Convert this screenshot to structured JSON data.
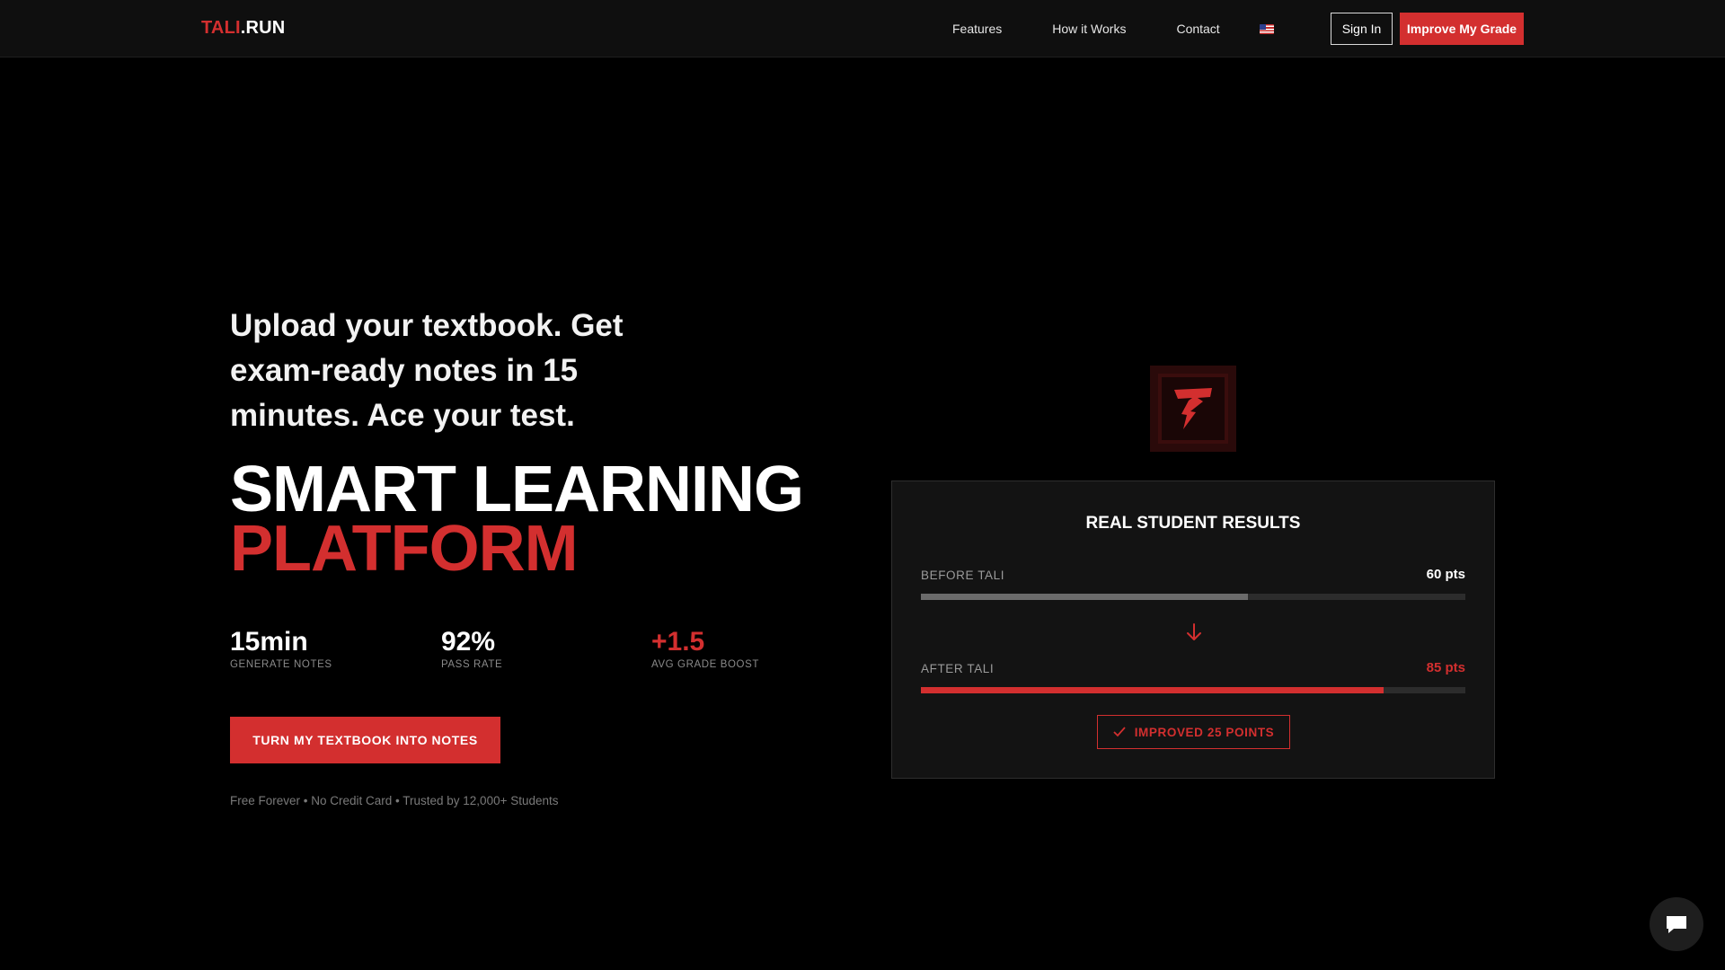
{
  "nav": {
    "logo_part1": "TALI",
    "logo_part2": ".RUN",
    "links": [
      "Features",
      "How it Works",
      "Contact"
    ],
    "language_icon": "us-flag-icon",
    "sign_in": "Sign In",
    "improve": "Improve My Grade"
  },
  "hero": {
    "tagline": "Upload your textbook. Get exam-ready notes in 15 minutes. Ace your test.",
    "headline_line1": "SMART LEARNING",
    "headline_line2": "PLATFORM",
    "stats": [
      {
        "value": "15min",
        "label": "GENERATE NOTES"
      },
      {
        "value": "92%",
        "label": "PASS RATE"
      },
      {
        "value": "+1.5",
        "label": "AVG GRADE BOOST"
      }
    ],
    "cta": "TURN MY TEXTBOOK INTO NOTES",
    "fine_print": "Free Forever • No Credit Card • Trusted by 12,000+ Students"
  },
  "results": {
    "emblem_icon": "lightning-t-logo-icon",
    "title": "REAL STUDENT RESULTS",
    "before_label": "BEFORE TALI",
    "before_value": "60 pts",
    "before_fraction": 0.6,
    "after_label": "AFTER TALI",
    "after_value": "85 pts",
    "after_fraction": 0.85,
    "badge": "IMPROVED 25 POINTS"
  },
  "colors": {
    "accent": "#d32f2f",
    "before_bar": "#6b6b6b",
    "track": "#2c2c2c"
  },
  "chat_icon": "chat-bubble-icon"
}
